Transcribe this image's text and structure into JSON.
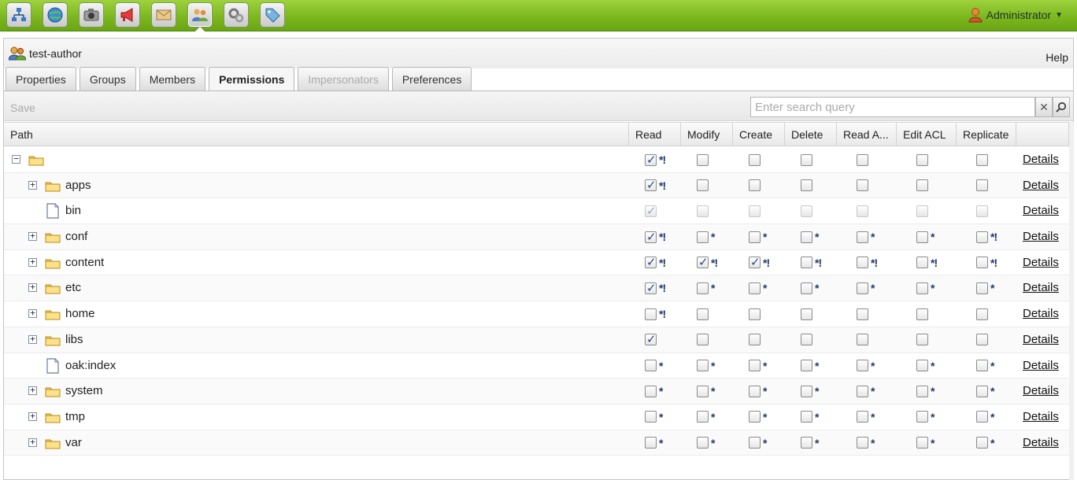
{
  "toolbar": {
    "icons": [
      "sitemap-icon",
      "globe-icon",
      "camera-icon",
      "megaphone-icon",
      "mail-icon",
      "users-icon",
      "gears-icon",
      "tag-icon"
    ],
    "active_index": 5,
    "user_label": "Administrator"
  },
  "panel": {
    "title": "test-author",
    "help": "Help"
  },
  "tabs": [
    {
      "label": "Properties",
      "state": "normal"
    },
    {
      "label": "Groups",
      "state": "normal"
    },
    {
      "label": "Members",
      "state": "normal"
    },
    {
      "label": "Permissions",
      "state": "active"
    },
    {
      "label": "Impersonators",
      "state": "disabled"
    },
    {
      "label": "Preferences",
      "state": "normal"
    }
  ],
  "actions": {
    "save": "Save",
    "search_placeholder": "Enter search query",
    "clear": "✕"
  },
  "columns": [
    "Path",
    "Read",
    "Modify",
    "Create",
    "Delete",
    "Read A...",
    "Edit ACL",
    "Replicate"
  ],
  "details_label": "Details",
  "rows": [
    {
      "name": "",
      "kind": "folder",
      "expander": "-",
      "indent": 0,
      "dim": false,
      "perms": [
        [
          1,
          "*!"
        ],
        [
          0,
          ""
        ],
        [
          0,
          ""
        ],
        [
          0,
          ""
        ],
        [
          0,
          ""
        ],
        [
          0,
          ""
        ],
        [
          0,
          ""
        ]
      ]
    },
    {
      "name": "apps",
      "kind": "folder",
      "expander": "+",
      "indent": 1,
      "dim": false,
      "perms": [
        [
          1,
          "*!"
        ],
        [
          0,
          ""
        ],
        [
          0,
          ""
        ],
        [
          0,
          ""
        ],
        [
          0,
          ""
        ],
        [
          0,
          ""
        ],
        [
          0,
          ""
        ]
      ]
    },
    {
      "name": "bin",
      "kind": "file",
      "expander": "",
      "indent": 1,
      "dim": true,
      "perms": [
        [
          1,
          ""
        ],
        [
          0,
          ""
        ],
        [
          0,
          ""
        ],
        [
          0,
          ""
        ],
        [
          0,
          ""
        ],
        [
          0,
          ""
        ],
        [
          0,
          ""
        ]
      ]
    },
    {
      "name": "conf",
      "kind": "folder",
      "expander": "+",
      "indent": 1,
      "dim": false,
      "perms": [
        [
          1,
          "*!"
        ],
        [
          0,
          "*"
        ],
        [
          0,
          "*"
        ],
        [
          0,
          "*"
        ],
        [
          0,
          "*"
        ],
        [
          0,
          "*"
        ],
        [
          0,
          "*!"
        ]
      ]
    },
    {
      "name": "content",
      "kind": "folder",
      "expander": "+",
      "indent": 1,
      "dim": false,
      "perms": [
        [
          1,
          "*!"
        ],
        [
          1,
          "*!"
        ],
        [
          1,
          "*!"
        ],
        [
          0,
          "*!"
        ],
        [
          0,
          "*!"
        ],
        [
          0,
          "*!"
        ],
        [
          0,
          "*!"
        ]
      ]
    },
    {
      "name": "etc",
      "kind": "folder",
      "expander": "+",
      "indent": 1,
      "dim": false,
      "perms": [
        [
          1,
          "*!"
        ],
        [
          0,
          "*"
        ],
        [
          0,
          "*"
        ],
        [
          0,
          "*"
        ],
        [
          0,
          "*"
        ],
        [
          0,
          "*"
        ],
        [
          0,
          "*"
        ]
      ]
    },
    {
      "name": "home",
      "kind": "folder",
      "expander": "+",
      "indent": 1,
      "dim": false,
      "perms": [
        [
          0,
          "*!"
        ],
        [
          0,
          ""
        ],
        [
          0,
          ""
        ],
        [
          0,
          ""
        ],
        [
          0,
          ""
        ],
        [
          0,
          ""
        ],
        [
          0,
          ""
        ]
      ]
    },
    {
      "name": "libs",
      "kind": "folder",
      "expander": "+",
      "indent": 1,
      "dim": false,
      "perms": [
        [
          1,
          ""
        ],
        [
          0,
          ""
        ],
        [
          0,
          ""
        ],
        [
          0,
          ""
        ],
        [
          0,
          ""
        ],
        [
          0,
          ""
        ],
        [
          0,
          ""
        ]
      ]
    },
    {
      "name": "oak:index",
      "kind": "file",
      "expander": "",
      "indent": 1,
      "dim": false,
      "perms": [
        [
          0,
          "*"
        ],
        [
          0,
          "*"
        ],
        [
          0,
          "*"
        ],
        [
          0,
          "*"
        ],
        [
          0,
          "*"
        ],
        [
          0,
          "*"
        ],
        [
          0,
          "*"
        ]
      ]
    },
    {
      "name": "system",
      "kind": "folder",
      "expander": "+",
      "indent": 1,
      "dim": false,
      "perms": [
        [
          0,
          "*"
        ],
        [
          0,
          "*"
        ],
        [
          0,
          "*"
        ],
        [
          0,
          "*"
        ],
        [
          0,
          "*"
        ],
        [
          0,
          "*"
        ],
        [
          0,
          "*"
        ]
      ]
    },
    {
      "name": "tmp",
      "kind": "folder",
      "expander": "+",
      "indent": 1,
      "dim": false,
      "perms": [
        [
          0,
          "*"
        ],
        [
          0,
          "*"
        ],
        [
          0,
          "*"
        ],
        [
          0,
          "*"
        ],
        [
          0,
          "*"
        ],
        [
          0,
          "*"
        ],
        [
          0,
          "*"
        ]
      ]
    },
    {
      "name": "var",
      "kind": "folder",
      "expander": "+",
      "indent": 1,
      "dim": false,
      "perms": [
        [
          0,
          "*"
        ],
        [
          0,
          "*"
        ],
        [
          0,
          "*"
        ],
        [
          0,
          "*"
        ],
        [
          0,
          "*"
        ],
        [
          0,
          "*"
        ],
        [
          0,
          "*"
        ]
      ]
    }
  ]
}
